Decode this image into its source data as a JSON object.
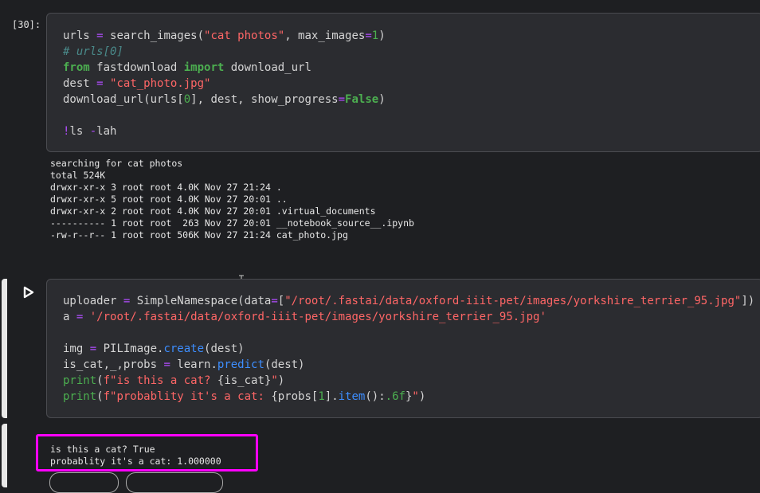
{
  "cell1": {
    "prompt": "[30]:",
    "code": [
      [
        [
          "urls ",
          "v"
        ],
        [
          "=",
          "o"
        ],
        [
          " search_images(",
          "v"
        ],
        [
          "\"cat photos\"",
          "s"
        ],
        [
          ", max_images",
          "v"
        ],
        [
          "=",
          "o"
        ],
        [
          "1",
          "n"
        ],
        [
          ")",
          "v"
        ]
      ],
      [
        [
          "# urls[0]",
          "c"
        ]
      ],
      [
        [
          "from",
          "k"
        ],
        [
          " fastdownload ",
          "v"
        ],
        [
          "import",
          "k"
        ],
        [
          " download_url",
          "v"
        ]
      ],
      [
        [
          "dest ",
          "v"
        ],
        [
          "=",
          "o"
        ],
        [
          " ",
          "v"
        ],
        [
          "\"cat_photo.jpg\"",
          "s"
        ]
      ],
      [
        [
          "download_url(urls[",
          "v"
        ],
        [
          "0",
          "n"
        ],
        [
          "], dest, show_progress",
          "v"
        ],
        [
          "=",
          "o"
        ],
        [
          "False",
          "k"
        ],
        [
          ")",
          "v"
        ]
      ],
      [],
      [
        [
          "!",
          "o"
        ],
        [
          "ls ",
          "v"
        ],
        [
          "-",
          "o"
        ],
        [
          "lah",
          "v"
        ]
      ]
    ],
    "output": [
      "searching for cat photos",
      "total 524K",
      "drwxr-xr-x 3 root root 4.0K Nov 27 21:24 .",
      "drwxr-xr-x 5 root root 4.0K Nov 27 20:01 ..",
      "drwxr-xr-x 2 root root 4.0K Nov 27 20:01 .virtual_documents",
      "---------- 1 root root  263 Nov 27 20:01 __notebook_source__.ipynb",
      "-rw-r--r-- 1 root root 506K Nov 27 21:24 cat_photo.jpg"
    ]
  },
  "cell2": {
    "code": [
      [
        [
          "uploader ",
          "v"
        ],
        [
          "=",
          "o"
        ],
        [
          " SimpleNamespace(data",
          "v"
        ],
        [
          "=",
          "o"
        ],
        [
          "[",
          "v"
        ],
        [
          "\"/root/.fastai/data/oxford-iiit-pet/images/yorkshire_terrier_95.jpg\"",
          "s"
        ],
        [
          "])",
          "v"
        ]
      ],
      [
        [
          "a ",
          "v"
        ],
        [
          "=",
          "o"
        ],
        [
          " ",
          "v"
        ],
        [
          "'/root/.fastai/data/oxford-iiit-pet/images/yorkshire_terrier_95.jpg'",
          "s"
        ]
      ],
      [],
      [
        [
          "img ",
          "v"
        ],
        [
          "=",
          "o"
        ],
        [
          " PILImage.",
          "v"
        ],
        [
          "create",
          "f"
        ],
        [
          "(dest)",
          "v"
        ]
      ],
      [
        [
          "is_cat,_,probs ",
          "v"
        ],
        [
          "=",
          "o"
        ],
        [
          " learn.",
          "v"
        ],
        [
          "predict",
          "f"
        ],
        [
          "(dest)",
          "v"
        ]
      ],
      [
        [
          "print",
          "b"
        ],
        [
          "(",
          "v"
        ],
        [
          "f\"is this a cat? ",
          "s"
        ],
        [
          "{is_cat}",
          "v"
        ],
        [
          "\"",
          "s"
        ],
        [
          ")",
          "v"
        ]
      ],
      [
        [
          "print",
          "b"
        ],
        [
          "(",
          "v"
        ],
        [
          "f\"probablity it's a cat: ",
          "s"
        ],
        [
          "{probs[",
          "v"
        ],
        [
          "1",
          "n"
        ],
        [
          "].",
          "v"
        ],
        [
          "item",
          "f"
        ],
        [
          "():",
          "v"
        ],
        [
          ".6f",
          "n"
        ],
        [
          "}",
          "v"
        ],
        [
          "\"",
          "s"
        ],
        [
          ")",
          "v"
        ]
      ]
    ],
    "output": [
      "is this a cat? True",
      "probablity it's a cat: 1.000000"
    ]
  },
  "colors": {
    "highlight": "#ff00ff",
    "background": "#1e1f22",
    "cell": "#2b2c30"
  }
}
